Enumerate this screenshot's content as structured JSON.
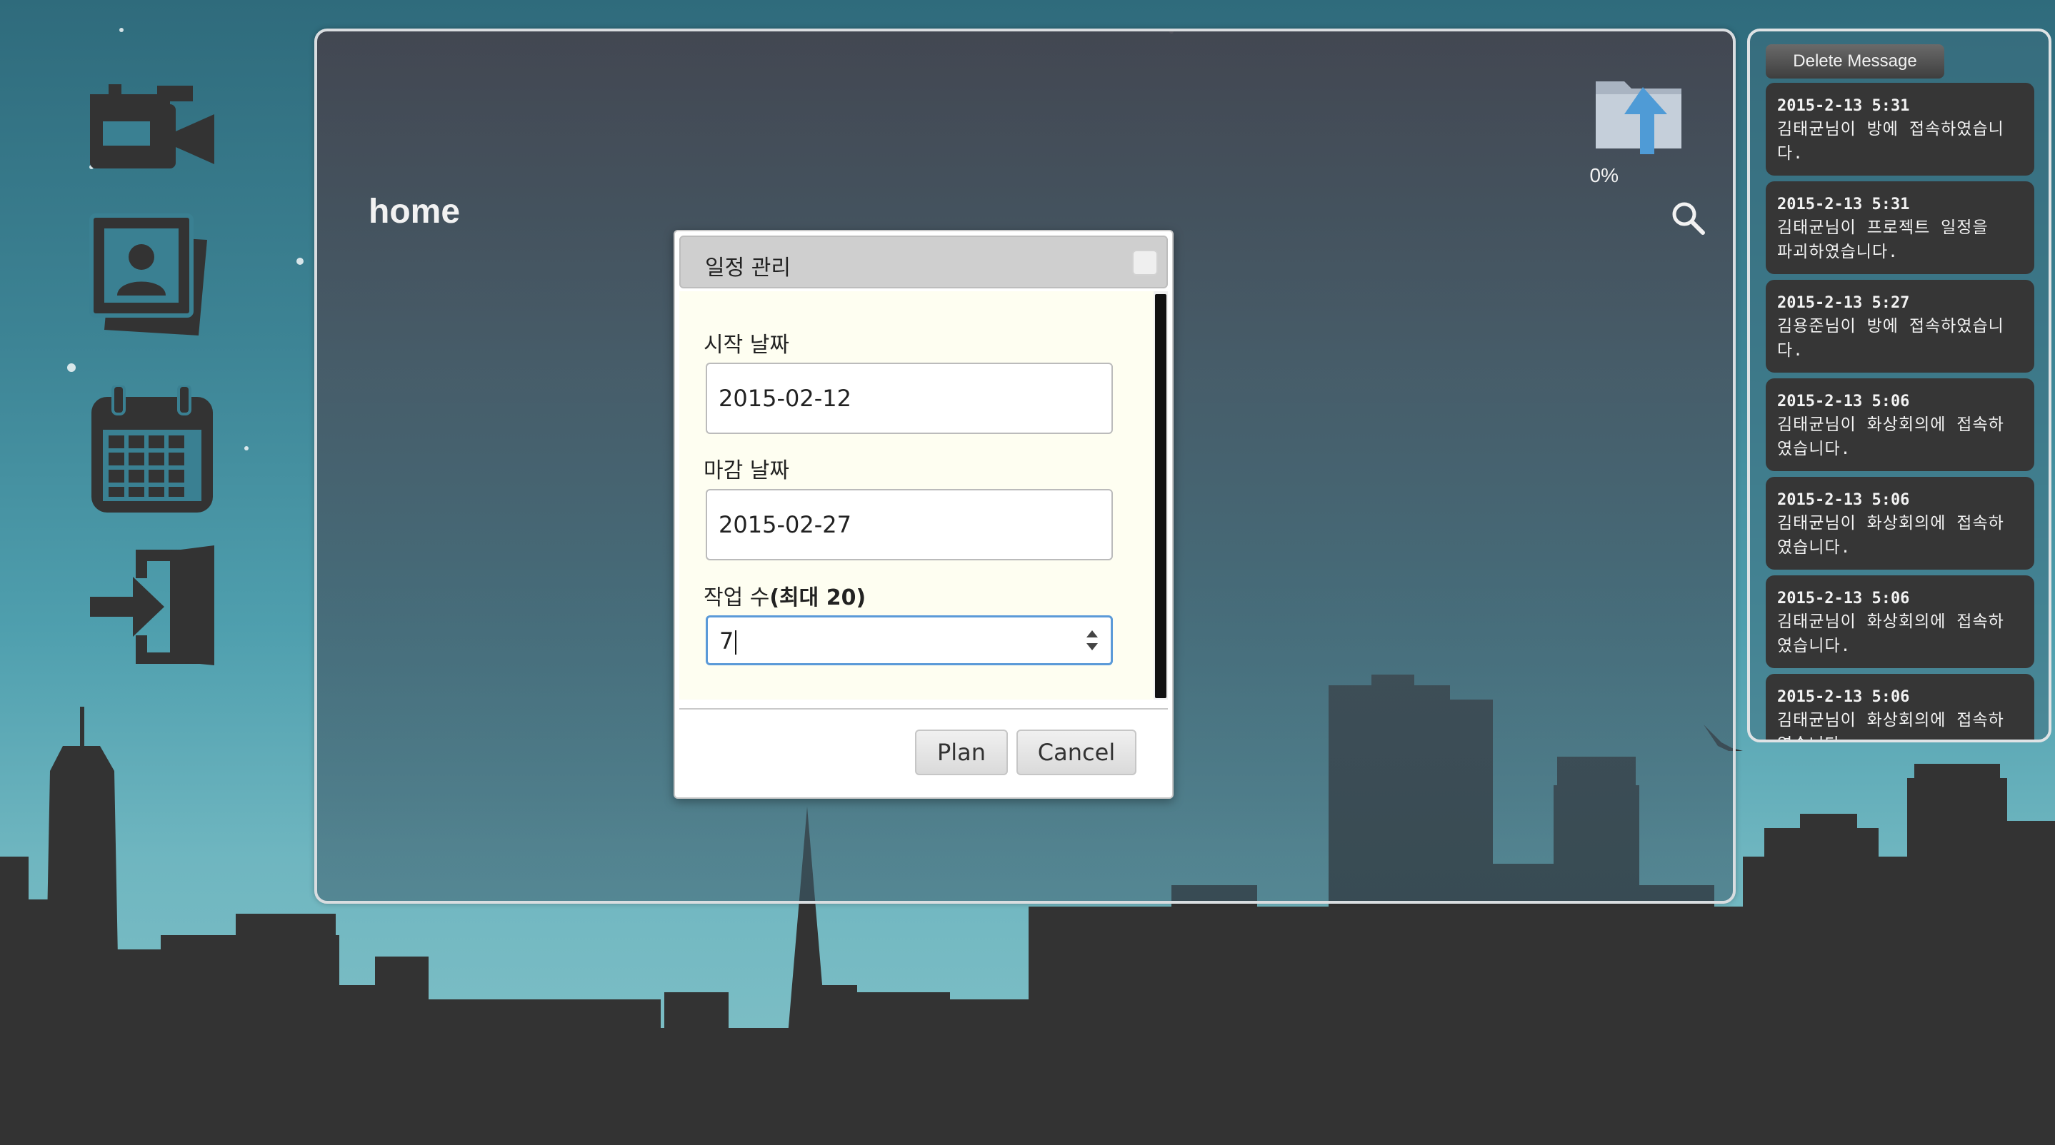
{
  "window": {
    "title": "home",
    "upload_progress": "0%"
  },
  "sidebar": {
    "items": [
      {
        "icon": "video-camera-icon",
        "label": ""
      },
      {
        "icon": "photo-album-icon",
        "label": ""
      },
      {
        "icon": "calendar-icon",
        "label": ""
      },
      {
        "icon": "exit-door-icon",
        "label": ""
      }
    ]
  },
  "dialog": {
    "title": "일정 관리",
    "start_label": "시작 날짜",
    "start_value": "2015-02-12",
    "end_label": "마감 날짜",
    "end_value": "2015-02-27",
    "tasks_label_prefix": "작업 수",
    "tasks_label_strong": "(최대 20)",
    "tasks_value": "7",
    "plan_button": "Plan",
    "cancel_button": "Cancel"
  },
  "messages": {
    "delete_button": "Delete Message",
    "items": [
      {
        "time": "2015-2-13 5:31",
        "line1": "김태균님이 방에 접속하였습니",
        "line2": "다."
      },
      {
        "time": "2015-2-13 5:31",
        "line1": "김태균님이 프로젝트 일정을",
        "line2": "파괴하였습니다."
      },
      {
        "time": "2015-2-13 5:27",
        "line1": "김용준님이 방에 접속하였습니",
        "line2": "다."
      },
      {
        "time": "2015-2-13 5:06",
        "line1": "김태균님이 화상회의에 접속하",
        "line2": "였습니다."
      },
      {
        "time": "2015-2-13 5:06",
        "line1": "김태균님이 화상회의에 접속하",
        "line2": "였습니다."
      },
      {
        "time": "2015-2-13 5:06",
        "line1": "김태균님이 화상회의에 접속하",
        "line2": "였습니다."
      },
      {
        "time": "2015-2-13 5:06",
        "line1": "김태균님이 화상회의에 접속하",
        "line2": "였습니다."
      }
    ]
  },
  "colors": {
    "sky_top": "#2f6b7c",
    "skyline": "#333333",
    "dialog_body": "#fefef1",
    "input_focus": "#5b9ad8"
  }
}
